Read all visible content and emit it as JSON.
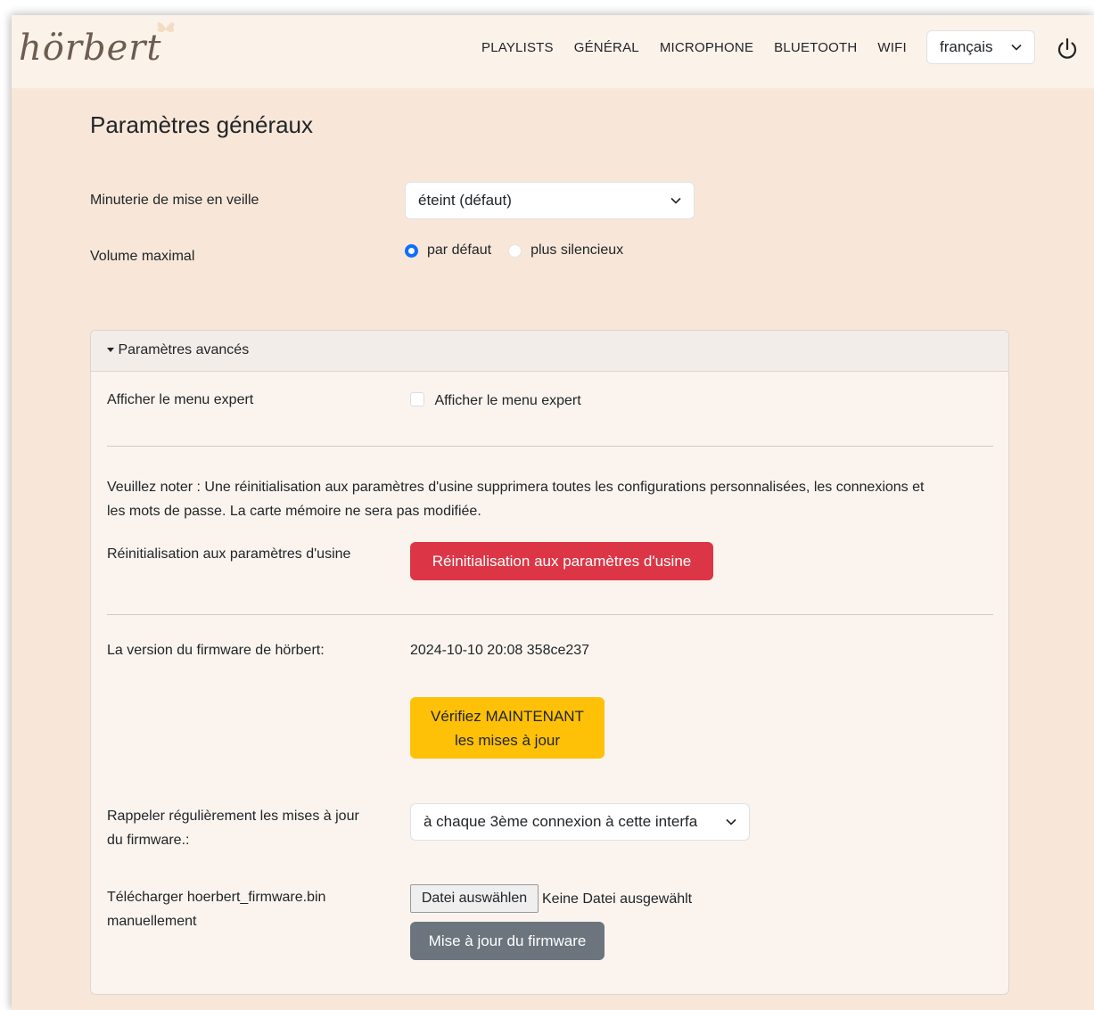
{
  "brand": {
    "logo_text": "hörbert"
  },
  "nav": {
    "items": [
      {
        "label": "PLAYLISTS"
      },
      {
        "label": "GÉNÉRAL"
      },
      {
        "label": "MICROPHONE"
      },
      {
        "label": "BLUETOOTH"
      },
      {
        "label": "WIFI"
      }
    ],
    "language": "français",
    "power_icon": "power-icon"
  },
  "page": {
    "title": "Paramètres généraux"
  },
  "general": {
    "sleep_timer_label": "Minuterie de mise en veille",
    "sleep_timer_value": "éteint (défaut)",
    "max_volume_label": "Volume maximal",
    "volume_option_default": "par défaut",
    "volume_option_quiet": "plus silencieux",
    "volume_selected": "par défaut"
  },
  "advanced": {
    "header": "Paramètres avancés",
    "expert_menu_label": "Afficher le menu expert",
    "expert_menu_checkbox_label": "Afficher le menu expert",
    "expert_menu_checked": false,
    "note_line1": "Veuillez noter : Une réinitialisation aux paramètres d'usine supprimera toutes les configurations personnalisées, les connexions et",
    "note_line2": "les mots de passe. La carte mémoire ne sera pas modifiée.",
    "factory_reset_label": "Réinitialisation aux paramètres d'usine",
    "factory_reset_button": "Réinitialisation aux paramètres d'usine",
    "firmware_version_label": "La version du firmware de hörbert:",
    "firmware_version_value": "2024-10-10 20:08 358ce237",
    "check_updates_line1": "Vérifiez MAINTENANT",
    "check_updates_line2": "les mises à jour",
    "reminder_label_line1": "Rappeler régulièrement les mises à jour",
    "reminder_label_line2": "du firmware.:",
    "reminder_value": "à chaque 3ème connexion à cette interfa",
    "upload_label_line1": "Télécharger hoerbert_firmware.bin",
    "upload_label_line2": "manuellement",
    "file_button": "Datei auswählen",
    "file_status": "Keine Datei ausgewählt",
    "update_button": "Mise à jour du firmware"
  },
  "colors": {
    "background": "#f8e7d8",
    "navbar": "#fbf2ea",
    "danger": "#dc3545",
    "warning": "#ffc107",
    "secondary": "#6c757d",
    "primary": "#0d6efd"
  }
}
